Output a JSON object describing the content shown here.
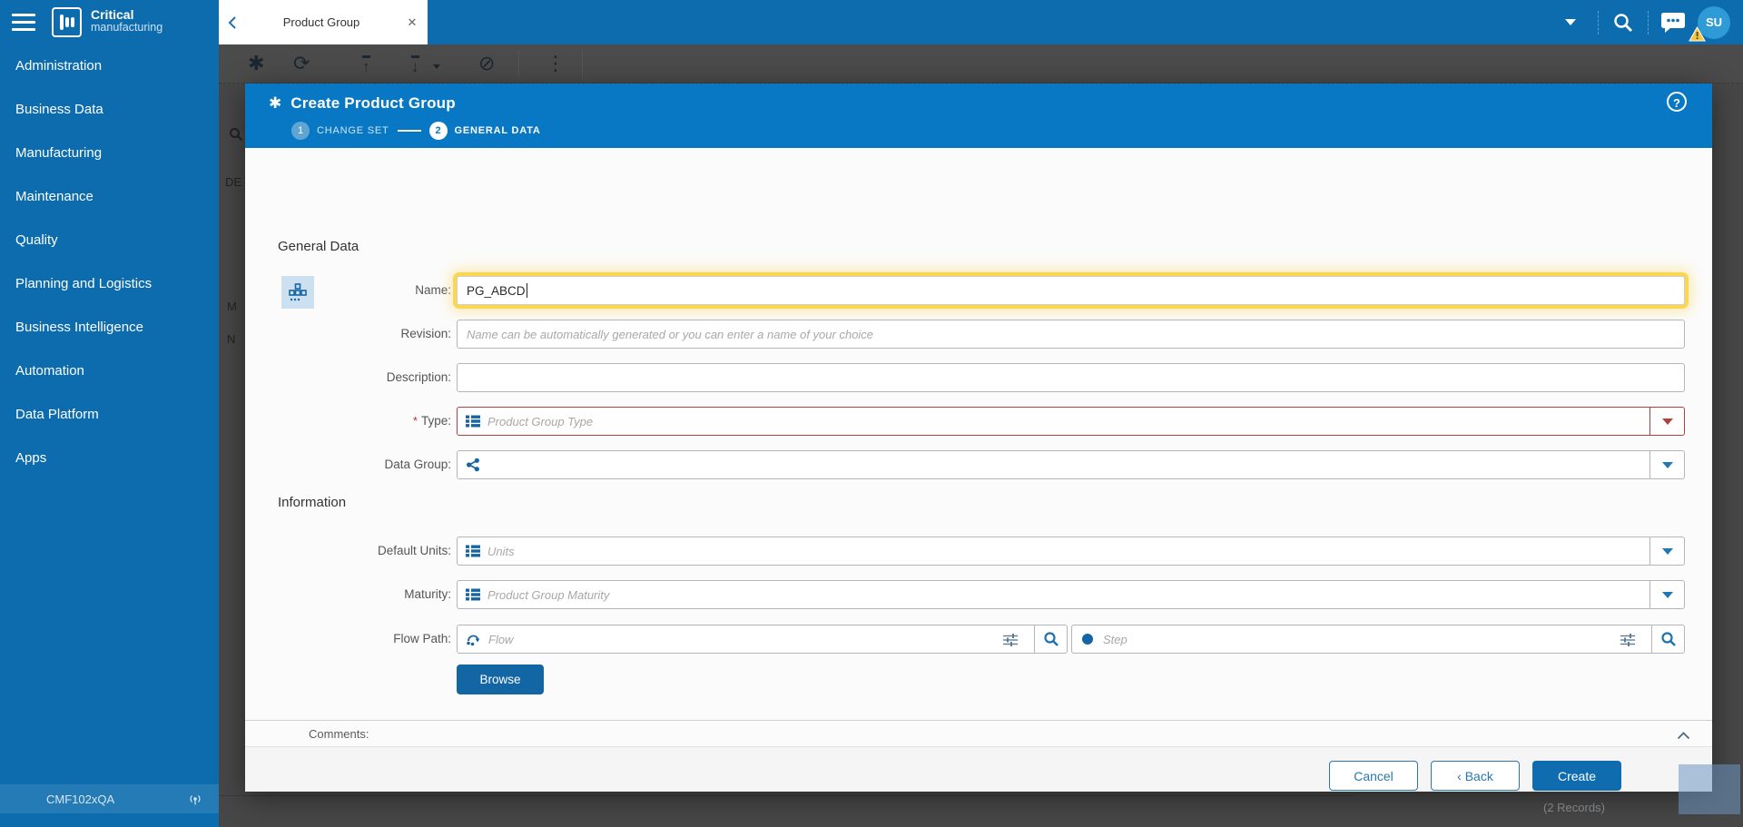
{
  "topbar": {
    "logo_line1": "Critical",
    "logo_line2": "manufacturing",
    "tab": {
      "title": "Product Group",
      "close_glyph": "✕"
    },
    "avatar_initials": "SU"
  },
  "sidebar": {
    "items": [
      {
        "label": "Administration"
      },
      {
        "label": "Business Data"
      },
      {
        "label": "Manufacturing"
      },
      {
        "label": "Maintenance"
      },
      {
        "label": "Quality"
      },
      {
        "label": "Planning and Logistics"
      },
      {
        "label": "Business Intelligence"
      },
      {
        "label": "Automation"
      },
      {
        "label": "Data Platform"
      },
      {
        "label": "Apps"
      }
    ],
    "footer": {
      "environment": "CMF102xQA"
    }
  },
  "background": {
    "toolbar_glyphs": {
      "new": "✱",
      "refresh": "⟳",
      "upload": "↑",
      "download": "↓",
      "gauge": "⊘",
      "more": "⋮"
    },
    "partial_texts": {
      "t1": "DE",
      "t2": "M",
      "t3": "N"
    },
    "records_count": "(2 Records)"
  },
  "dialog": {
    "title": "Create Product Group",
    "title_glyph": "✱",
    "help_glyph": "?",
    "steps": [
      {
        "number": "1",
        "label": "CHANGE SET"
      },
      {
        "number": "2",
        "label": "GENERAL DATA"
      }
    ],
    "sections": {
      "general": "General Data",
      "information": "Information"
    },
    "fields": {
      "name": {
        "label": "Name:",
        "value": "PG_ABCD"
      },
      "revision": {
        "label": "Revision:",
        "placeholder": "Name can be automatically generated or you can enter a name of your choice"
      },
      "description": {
        "label": "Description:"
      },
      "type": {
        "label": "Type:",
        "required_marker": "*",
        "placeholder": "Product Group Type"
      },
      "data_group": {
        "label": "Data Group:"
      },
      "default_units": {
        "label": "Default Units:",
        "placeholder": "Units"
      },
      "maturity": {
        "label": "Maturity:",
        "placeholder": "Product Group Maturity"
      },
      "flow_path": {
        "label": "Flow Path:",
        "flow_placeholder": "Flow",
        "step_placeholder": "Step"
      }
    },
    "browse_button": "Browse",
    "comments_label": "Comments:",
    "footer": {
      "cancel": "Cancel",
      "back_chevron": "‹",
      "back": "Back",
      "create": "Create"
    }
  }
}
